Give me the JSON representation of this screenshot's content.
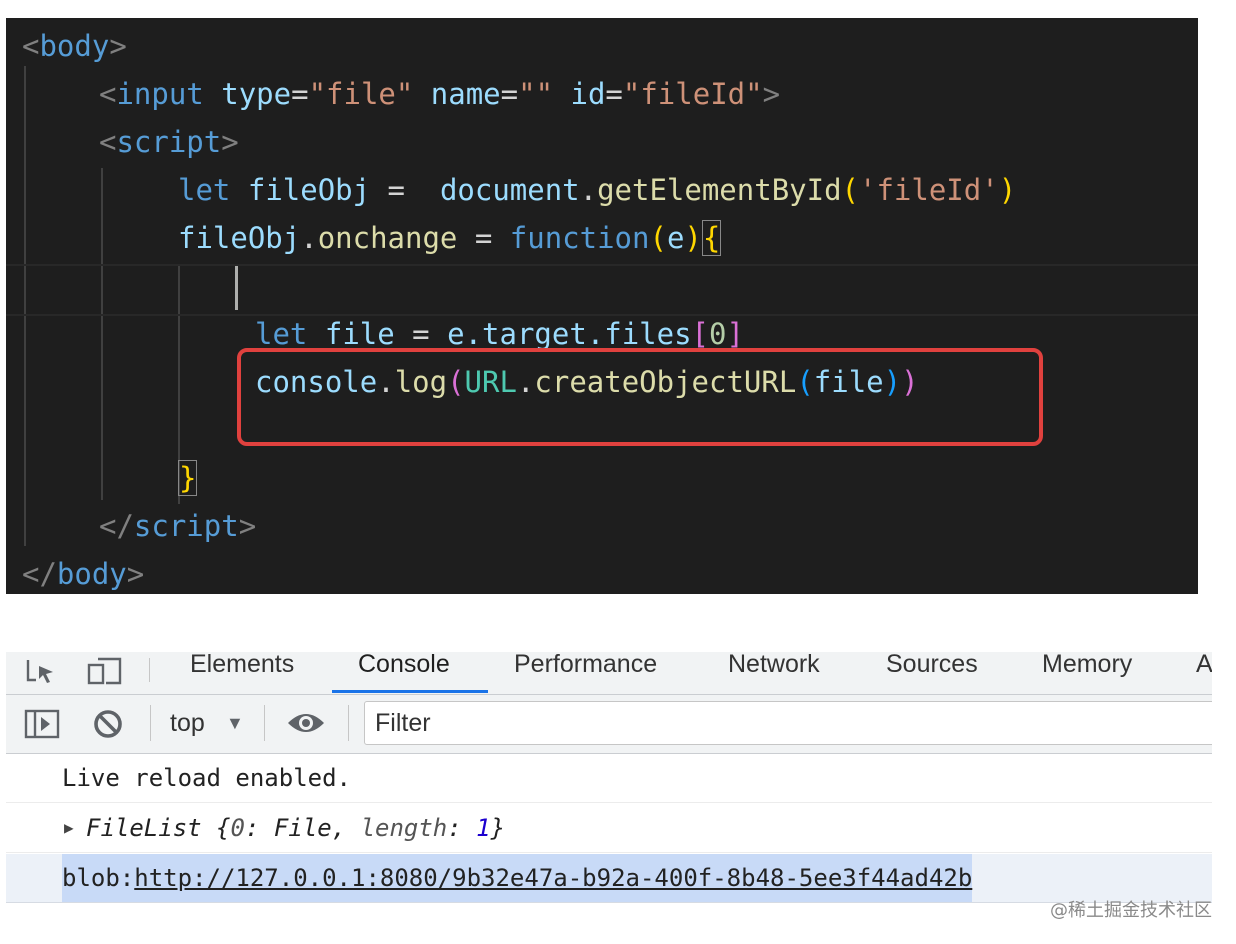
{
  "code": {
    "body_open": "body",
    "input_tag": "input",
    "attr_type": "type",
    "val_file": "\"file\"",
    "attr_name": "name",
    "val_empty": "\"\"",
    "attr_id": "id",
    "val_fileid": "\"fileId\"",
    "script_tag": "script",
    "kw_let": "let",
    "var_fileobj": "fileObj",
    "op_eq": "=",
    "var_document": "document",
    "fn_getelement": "getElementById",
    "str_fileid": "'fileId'",
    "prop_onchange": "onchange",
    "kw_function": "function",
    "param_e": "e",
    "var_file": "file",
    "expr_target": "e.target.files",
    "num_zero": "0",
    "var_console": "console",
    "fn_log": "log",
    "cls_url": "URL",
    "fn_createobjecturl": "createObjectURL",
    "brace_open": "{",
    "brace_close": "}"
  },
  "devtools": {
    "tabs": [
      "Elements",
      "Console",
      "Performance",
      "Network",
      "Sources",
      "Memory",
      "A"
    ],
    "active_tab": "Console",
    "context": "top",
    "filter_placeholder": "Filter"
  },
  "console": {
    "row1": "Live reload enabled.",
    "row2_name": "FileList",
    "row2_open": "{",
    "row2_key0": "0",
    "row2_val0": "File",
    "row2_key1": "length",
    "row2_val1": "1",
    "row2_close": "}",
    "row3_prefix": "blob:",
    "row3_link": "http://127.0.0.1:8080/9b32e47a-b92a-400f-8b48-5ee3f44ad42b"
  },
  "watermark": "@稀土掘金技术社区"
}
